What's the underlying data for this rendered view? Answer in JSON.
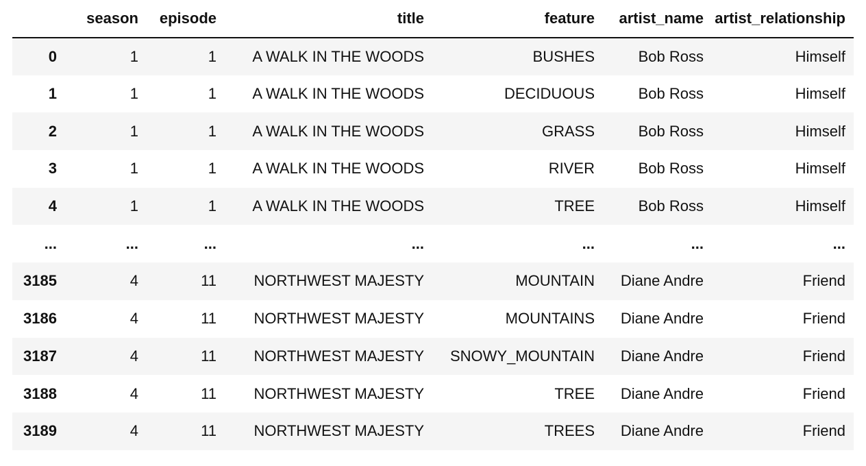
{
  "table": {
    "index_header": "",
    "columns": [
      "season",
      "episode",
      "title",
      "feature",
      "artist_name",
      "artist_relationship"
    ],
    "rows": [
      {
        "index": "0",
        "cells": [
          "1",
          "1",
          "A WALK IN THE WOODS",
          "BUSHES",
          "Bob Ross",
          "Himself"
        ]
      },
      {
        "index": "1",
        "cells": [
          "1",
          "1",
          "A WALK IN THE WOODS",
          "DECIDUOUS",
          "Bob Ross",
          "Himself"
        ]
      },
      {
        "index": "2",
        "cells": [
          "1",
          "1",
          "A WALK IN THE WOODS",
          "GRASS",
          "Bob Ross",
          "Himself"
        ]
      },
      {
        "index": "3",
        "cells": [
          "1",
          "1",
          "A WALK IN THE WOODS",
          "RIVER",
          "Bob Ross",
          "Himself"
        ]
      },
      {
        "index": "4",
        "cells": [
          "1",
          "1",
          "A WALK IN THE WOODS",
          "TREE",
          "Bob Ross",
          "Himself"
        ]
      },
      {
        "index": "...",
        "cells": [
          "...",
          "...",
          "...",
          "...",
          "...",
          "..."
        ]
      },
      {
        "index": "3185",
        "cells": [
          "4",
          "11",
          "NORTHWEST MAJESTY",
          "MOUNTAIN",
          "Diane Andre",
          "Friend"
        ]
      },
      {
        "index": "3186",
        "cells": [
          "4",
          "11",
          "NORTHWEST MAJESTY",
          "MOUNTAINS",
          "Diane Andre",
          "Friend"
        ]
      },
      {
        "index": "3187",
        "cells": [
          "4",
          "11",
          "NORTHWEST MAJESTY",
          "SNOWY_MOUNTAIN",
          "Diane Andre",
          "Friend"
        ]
      },
      {
        "index": "3188",
        "cells": [
          "4",
          "11",
          "NORTHWEST MAJESTY",
          "TREE",
          "Diane Andre",
          "Friend"
        ]
      },
      {
        "index": "3189",
        "cells": [
          "4",
          "11",
          "NORTHWEST MAJESTY",
          "TREES",
          "Diane Andre",
          "Friend"
        ]
      }
    ]
  },
  "colors": {
    "stripe": "#f5f5f5",
    "text": "#111111",
    "header_rule": "#111111"
  }
}
